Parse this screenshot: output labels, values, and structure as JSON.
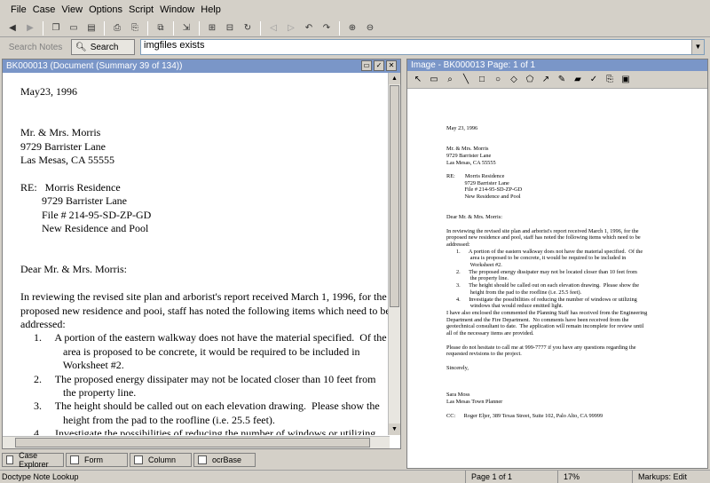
{
  "menu": [
    "File",
    "Case",
    "View",
    "Options",
    "Script",
    "Window",
    "Help"
  ],
  "search": {
    "notes_label": "Search Notes",
    "button_label": "Search",
    "query": "imgfiles exists"
  },
  "document": {
    "title": "BK000013 (Document (Summary 39 of 134))",
    "lines": [
      "May23, 1996",
      "",
      "",
      "Mr. & Mrs. Morris",
      "9729 Barrister Lane",
      "Las Mesas, CA 55555",
      "",
      "RE:   Morris Residence",
      "        9729 Barrister Lane",
      "        File # 214-95-SD-ZP-GD",
      "        New Residence and Pool",
      "",
      "",
      "Dear Mr. & Mrs. Morris:",
      "",
      "In reviewing the revised site plan and arborist's report received March 1, 1996, for the",
      "proposed new residence and pooi, staff has noted the following items which need to be",
      "addressed:",
      "     1.     A portion of the eastern walkway does not have the material specified.  Of the",
      "                area is proposed to be concrete, it would be required to be included in",
      "                Worksheet #2.",
      "     2.     The proposed energy dissipater may not be located closer than 10 feet from",
      "                the property line.",
      "     3.     The height should be called out on each elevation drawing.  Please show the",
      "                height from the pad to the roofline (i.e. 25.5 feet).",
      "     4.     Investigate the possibilities of reducing the number of windows or utilizing",
      "                windows that would reduce emitted light.",
      "I have also enclosed the commented the Planning Staff has received from the Engineering",
      "Department and the Fire Department.  No comments have been received from the",
      "geotechnical consultant to date.  The application will remain incomplete for review until"
    ]
  },
  "image": {
    "title": "Image - BK000013 Page: 1 of 1",
    "lines": [
      "May 23, 1996",
      "",
      "",
      "Mr. & Mrs. Morris",
      "9729 Barrister Lane",
      "Las Mesas, CA 55555",
      "",
      "RE:       Morris Residence",
      "             9729 Barrister Lane",
      "             File # 214-95-SD-ZP-GD",
      "             New Residence and Pool",
      "",
      "",
      "Dear Mr. & Mrs. Morris:",
      "",
      "In reviewing the revised site plan and arborist's report received March 1, 1996, for the",
      "proposed new residence and pool, staff has noted the following items which need to be",
      "addressed:",
      "       1.      A portion of the eastern walkway does not have the material specified.  Of the",
      "                 area is proposed to be concrete, it would be required to be included in",
      "                 Worksheet #2.",
      "       2.      The proposed energy dissipater may not be located closer than 10 feet from",
      "                 the property line.",
      "       3.      The height should be called out on each elevation drawing.  Please show the",
      "                 height from the pad to the roofline (i.e. 25.5 feet).",
      "       4.      Investigate the possibilities of reducing the number of windows or utilizing",
      "                 windows that would reduce emitted light.",
      "I have also enclosed the commented the Planning Staff has received from the Engineering",
      "Department and the Fire Department.  No comments have been received from the",
      "geotechnical consultant to date.  The application will remain incomplete for review until",
      "all of the necessary items are provided.",
      "",
      "Please do not hesitate to call me at 999-7777 if you have any questions regarding the",
      "requested revisions to the project.",
      "",
      "Sincerely,",
      "",
      "",
      "",
      "Sara Moss",
      "Las Mesas Town Planner",
      "",
      "CC:      Roger Eljer, 389 Texas Street, Suite 102, Palo Alto, CA 99999"
    ]
  },
  "tabs": [
    "Case Explorer",
    "Form",
    "Column",
    "ocrBase"
  ],
  "status": {
    "left": "Doctype Note  Lookup",
    "page": "Page 1 of 1",
    "zoom": "17%",
    "markups": "Markups: Edit"
  }
}
